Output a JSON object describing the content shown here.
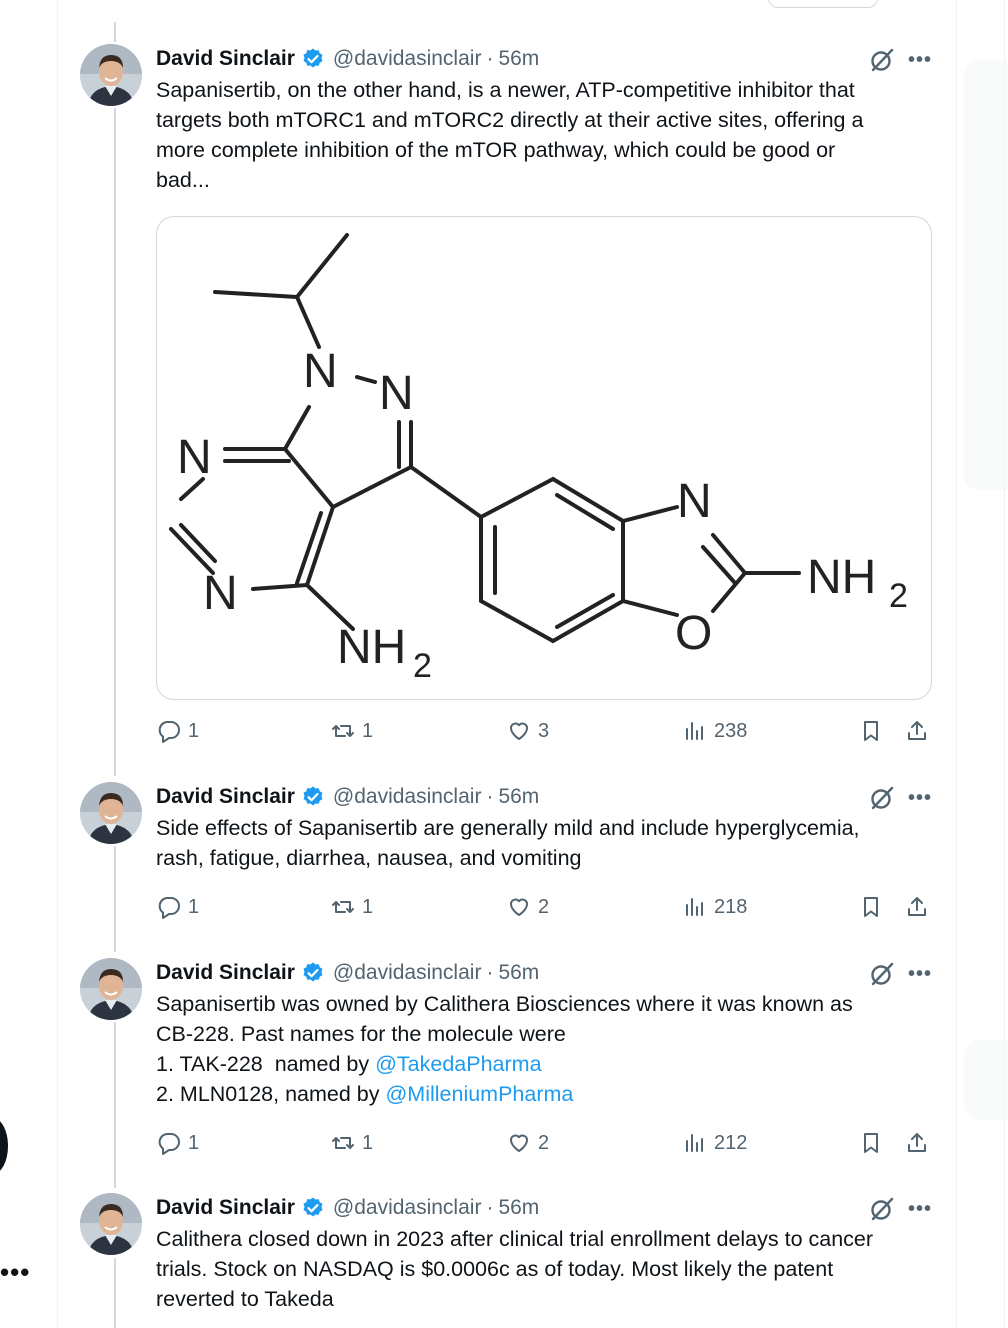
{
  "tweets": [
    {
      "author": "David Sinclair",
      "handle": "@davidasinclair",
      "dot": "·",
      "time": "56m",
      "lines": [
        "Sapanisertib, on the other hand, is a newer, ATP-competitive inhibitor that",
        "targets both mTORC1 and mTORC2 directly at their active sites, offering a",
        "more complete inhibition of the mTOR pathway, which could be good or",
        "bad..."
      ],
      "media": {
        "labels": {
          "n_top_left": "N",
          "n_top_right": "N",
          "n_left": "N",
          "n_bottom": "N",
          "nh2_left": "NH",
          "nh2_left_sub": "2",
          "n_ring": "N",
          "o_ring": "O",
          "nh2_right": "NH",
          "nh2_right_sub": "2"
        }
      },
      "replies": "1",
      "retweets": "1",
      "likes": "3",
      "views": "238"
    },
    {
      "author": "David Sinclair",
      "handle": "@davidasinclair",
      "dot": "·",
      "time": "56m",
      "lines": [
        "Side effects of Sapanisertib are generally mild and include hyperglycemia,",
        "rash, fatigue, diarrhea, nausea, and vomiting"
      ],
      "replies": "1",
      "retweets": "1",
      "likes": "2",
      "views": "218"
    },
    {
      "author": "David Sinclair",
      "handle": "@davidasinclair",
      "dot": "·",
      "time": "56m",
      "lines": [
        "Sapanisertib was owned by Calithera Biosciences where it was known as",
        "CB-228. Past names for the molecule were"
      ],
      "list_1_prefix": "1. TAK-228  named by ",
      "list_1_mention": "@TakedaPharma",
      "list_2_prefix": "2. MLN0128, named by ",
      "list_2_mention": "@MilleniumPharma",
      "replies": "1",
      "retweets": "1",
      "likes": "2",
      "views": "212"
    },
    {
      "author": "David Sinclair",
      "handle": "@davidasinclair",
      "dot": "·",
      "time": "56m",
      "lines": [
        "Calithera closed down in 2023 after clinical trial enrollment delays to cancer",
        "trials. Stock on NASDAQ is $0.0006c as of today. Most likely the patent",
        "reverted to Takeda"
      ]
    }
  ],
  "left_edge_menu": "•••",
  "colors": {
    "text": "#0f1419",
    "secondary": "#536471",
    "link": "#1d9bf0",
    "verified": "#1d9bf0",
    "border": "#cfd9de"
  }
}
